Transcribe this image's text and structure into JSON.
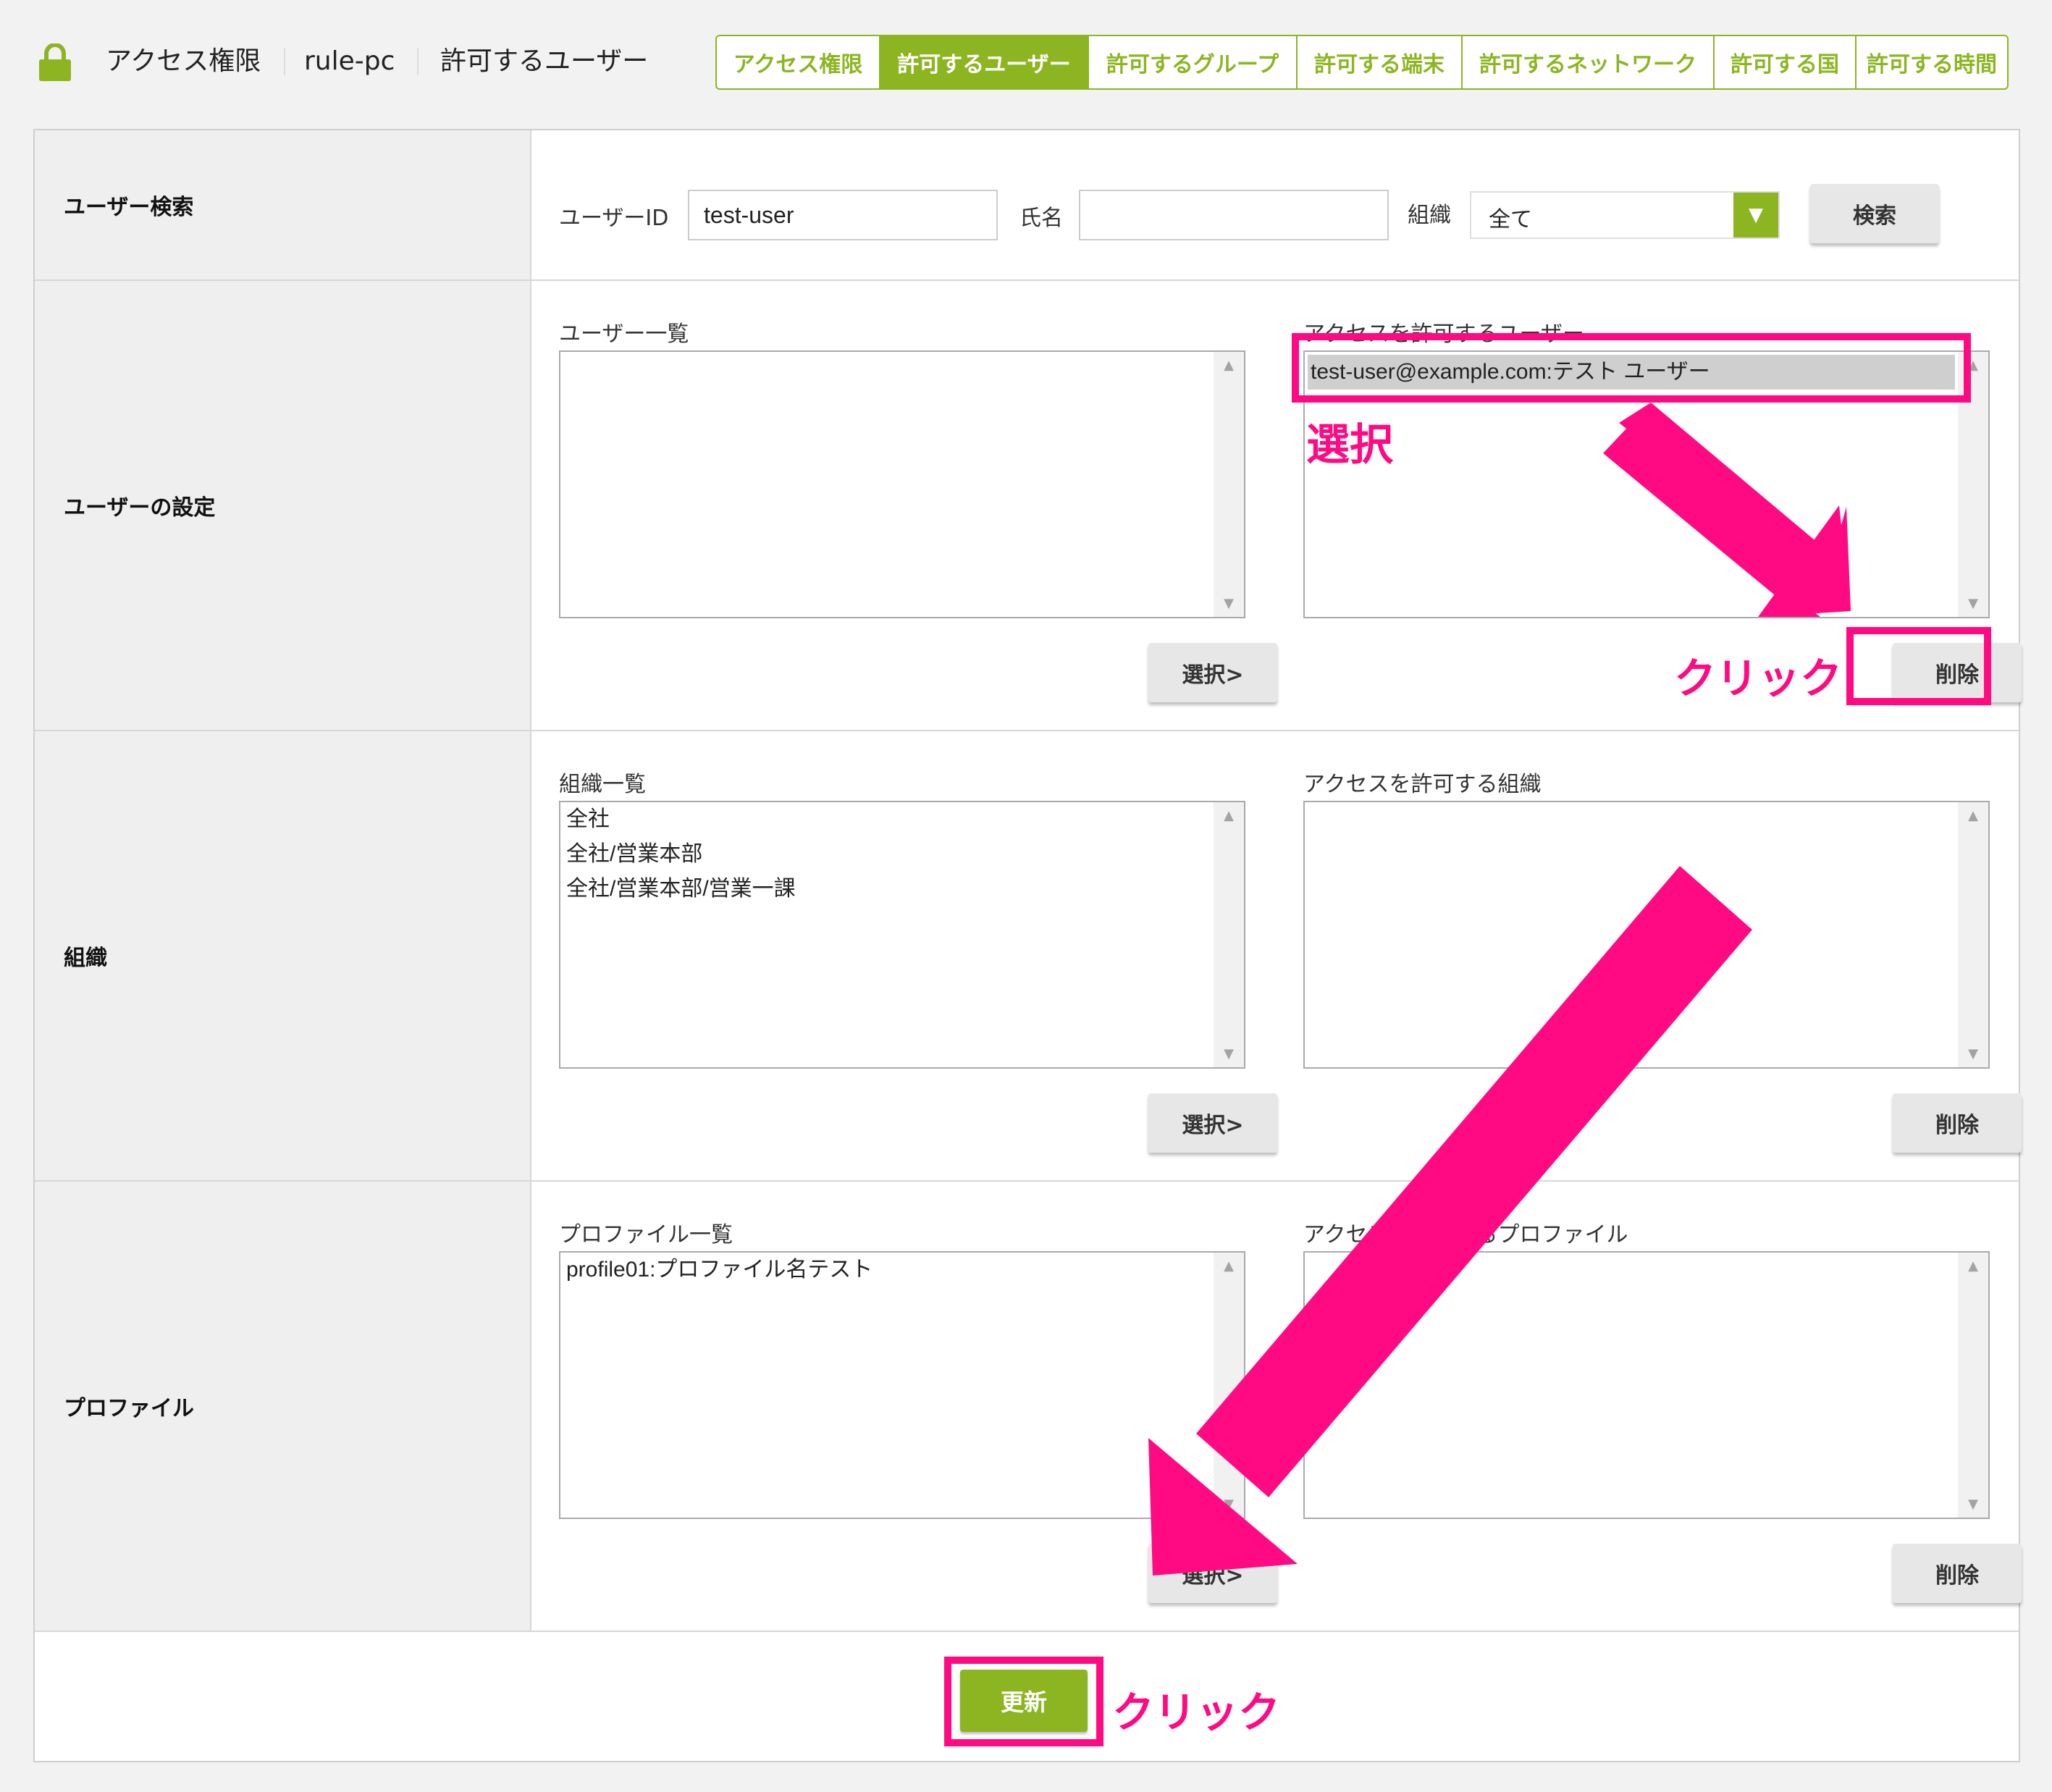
{
  "header": {
    "breadcrumb": [
      "アクセス権限",
      "rule-pc",
      "許可するユーザー"
    ],
    "tabs": [
      {
        "label": "アクセス権限",
        "active": false
      },
      {
        "label": "許可するユーザー",
        "active": true
      },
      {
        "label": "許可するグループ",
        "active": false
      },
      {
        "label": "許可する端末",
        "active": false
      },
      {
        "label": "許可するネットワーク",
        "active": false
      },
      {
        "label": "許可する国",
        "active": false
      },
      {
        "label": "許可する時間",
        "active": false
      }
    ]
  },
  "search": {
    "section_label": "ユーザー検索",
    "user_id_label": "ユーザーID",
    "user_id_value": "test-user",
    "name_label": "氏名",
    "name_value": "",
    "org_label": "組織",
    "org_value": "全て",
    "search_button": "検索"
  },
  "user_settings": {
    "section_label": "ユーザーの設定",
    "left_title": "ユーザー一覧",
    "left_items": [],
    "right_title": "アクセスを許可するユーザー",
    "right_items": [
      "test-user@example.com:テスト ユーザー"
    ],
    "select_button": "選択>",
    "delete_button": "削除"
  },
  "organization": {
    "section_label": "組織",
    "left_title": "組織一覧",
    "left_items": [
      "全社",
      "全社/営業本部",
      "全社/営業本部/営業一課"
    ],
    "right_title": "アクセスを許可する組織",
    "right_items": [],
    "select_button": "選択>",
    "delete_button": "削除"
  },
  "profile": {
    "section_label": "プロファイル",
    "left_title": "プロファイル一覧",
    "left_items": [
      "profile01:プロファイル名テスト"
    ],
    "right_title": "アクセスを許可するプロファイル",
    "right_items": [],
    "select_button": "選択>",
    "delete_button": "削除"
  },
  "footer": {
    "update_button": "更新"
  },
  "annotations": {
    "select_text": "選択",
    "click_text_delete": "クリック",
    "click_text_update": "クリック",
    "color": "#ff0a83"
  },
  "colors": {
    "accent": "#8db522",
    "annotation": "#ff0a83"
  }
}
